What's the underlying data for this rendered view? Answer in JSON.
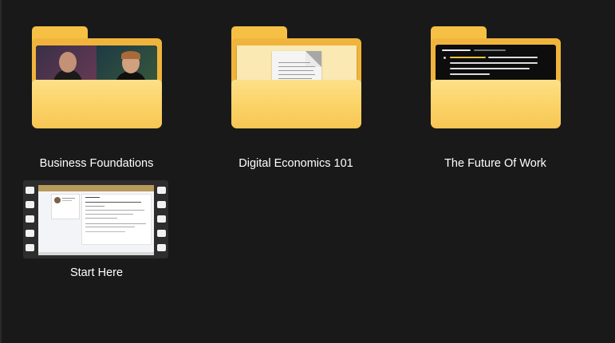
{
  "window": {
    "background": "#191919"
  },
  "items": [
    {
      "label": "Business Foundations",
      "type": "folder",
      "icon": "folder-icon",
      "preview": "video-call-thumbnail"
    },
    {
      "label": "Digital Economics 101",
      "type": "folder",
      "icon": "folder-icon",
      "preview": "document-thumbnail"
    },
    {
      "label": "The Future Of Work",
      "type": "folder",
      "icon": "folder-icon",
      "preview": "dark-slide-thumbnail"
    },
    {
      "label": "Start Here",
      "type": "video",
      "icon": "video-file-icon",
      "preview": "webpage-thumbnail"
    }
  ],
  "colors": {
    "folder_back": "#f0b43c",
    "folder_tab": "#f6c044",
    "folder_front": "#fcd66d",
    "folder_front_edge": "#f7c654",
    "film_strip": "#2d2d2d",
    "label_text": "#ffffff"
  }
}
